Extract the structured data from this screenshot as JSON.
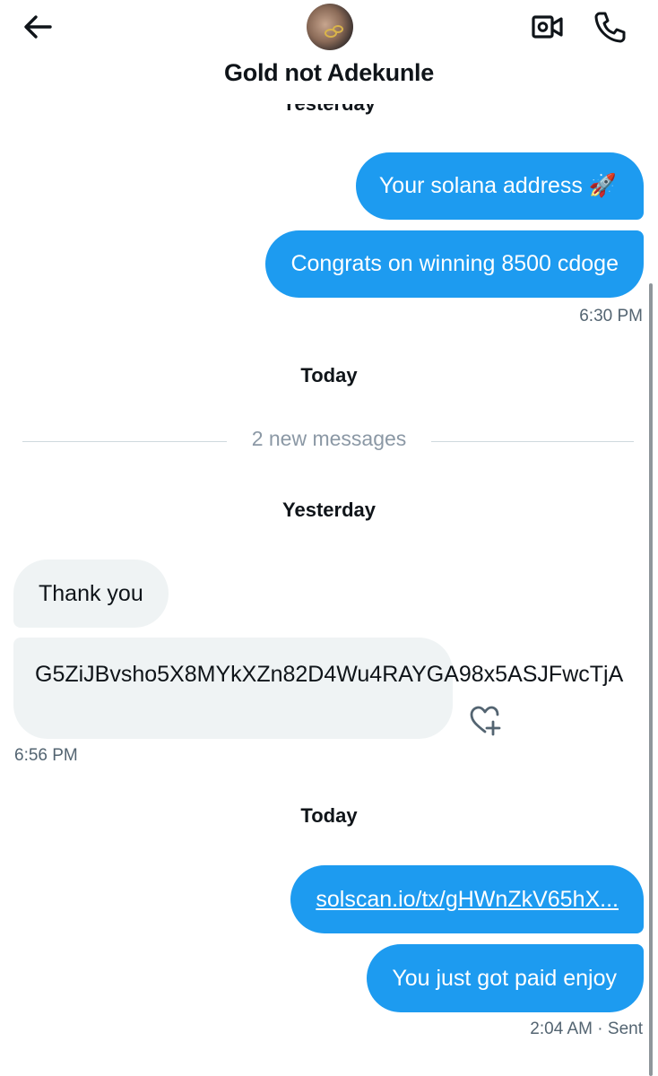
{
  "header": {
    "contact_name": "Gold not Adekunle",
    "back_icon": "arrow-left-icon",
    "video_icon": "video-camera-icon",
    "phone_icon": "phone-icon"
  },
  "thread": {
    "top_day_label": "Yesterday",
    "sent_1": "Your solana address 🚀",
    "sent_2": "Congrats on winning 8500 cdoge",
    "sent_time_1": "6:30 PM",
    "day_today_1": "Today",
    "new_messages": "2 new messages",
    "day_yesterday": "Yesterday",
    "recv_1": "Thank you",
    "recv_2": "G5ZiJBvsho5X8MYkXZn82D4Wu4RAYGA98x5ASJFwcTjA",
    "recv_time": "6:56 PM",
    "day_today_2": "Today",
    "sent_link": "solscan.io/tx/gHWnZkV65hX...",
    "sent_3": "You just got paid enjoy",
    "sent_time_2": "2:04 AM",
    "sent_status": "· Sent"
  },
  "colors": {
    "outgoing_bubble": "#1d9bf0",
    "incoming_bubble": "#eff3f4",
    "meta_text": "#536471"
  }
}
